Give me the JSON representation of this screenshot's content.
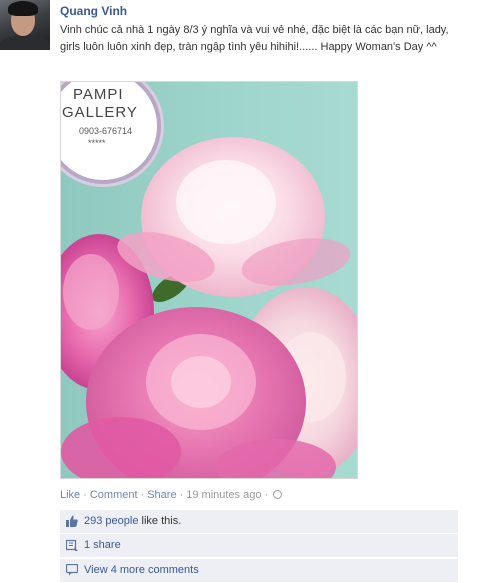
{
  "post": {
    "author": "Quang Vinh",
    "message": "Vinh chúc cả nhà 1 ngày 8/3 ý nghĩa và vui vẻ nhé, đặc biệt là các bạn nữ, lady, girls luôn luôn xinh đẹp, tràn ngập tình yêu hihihi!...... Happy Woman's Day ^^",
    "photo": {
      "logo_line1": "PAMPI",
      "logo_line2": "GALLERY",
      "logo_phone": "0903-676714",
      "logo_stars": "*****"
    },
    "actions": {
      "like": "Like",
      "comment": "Comment",
      "share": "Share",
      "time": "19 minutes ago",
      "separator": "·"
    },
    "ufi": {
      "likes_count": "293 people",
      "likes_suffix": " like this.",
      "shares": "1 share",
      "comments": "View 4 more comments"
    }
  },
  "colors": {
    "link": "#3b5998",
    "action_link": "#6d84b4",
    "ufi_bg": "#edeff4",
    "photo_bg": "#9fd6cc",
    "peony_pink": "#e35fa8",
    "peony_white": "#f7e2ea"
  },
  "icons": [
    "globe-icon",
    "thumbs-up-icon",
    "share-icon",
    "comment-icon"
  ]
}
